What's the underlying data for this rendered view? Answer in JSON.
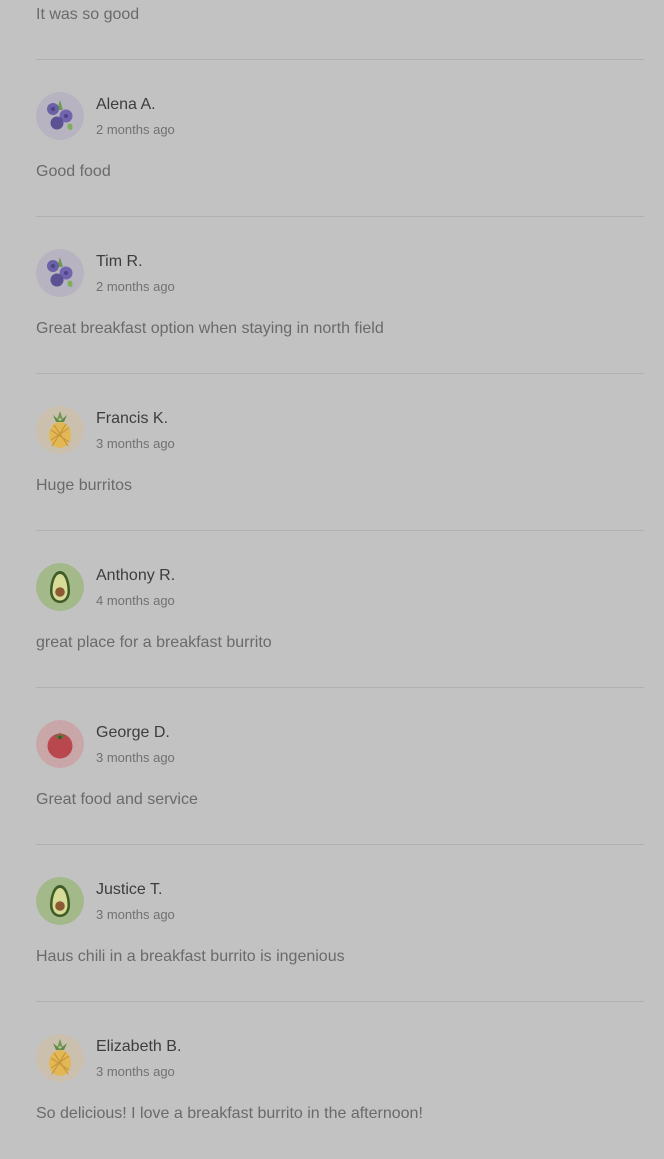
{
  "top_partial_review": {
    "text": "It was so good"
  },
  "reviews": [
    {
      "name": "Alena A.",
      "time": "2 months ago",
      "text": "Good food",
      "avatar": "blueberry-icon"
    },
    {
      "name": "Tim R.",
      "time": "2 months ago",
      "text": "Great breakfast option when staying in north field",
      "avatar": "blueberry-icon"
    },
    {
      "name": "Francis K.",
      "time": "3 months ago",
      "text": "Huge burritos",
      "avatar": "pineapple-icon"
    },
    {
      "name": "Anthony R.",
      "time": "4 months ago",
      "text": "great place for a breakfast burrito",
      "avatar": "avocado-icon"
    },
    {
      "name": "George D.",
      "time": "3 months ago",
      "text": "Great food and service",
      "avatar": "tomato-icon"
    },
    {
      "name": "Justice T.",
      "time": "3 months ago",
      "text": "Haus chili in a breakfast burrito is ingenious",
      "avatar": "avocado-icon"
    },
    {
      "name": "Elizabeth B.",
      "time": "3 months ago",
      "text": "So delicious! I love a breakfast burrito in the afternoon!",
      "avatar": "pineapple-icon"
    }
  ],
  "colors": {
    "overlay_background": "#c2c2c2",
    "divider": "#b1b1b1",
    "name_text": "#3d3d3d",
    "body_text": "#6a6a6a"
  }
}
